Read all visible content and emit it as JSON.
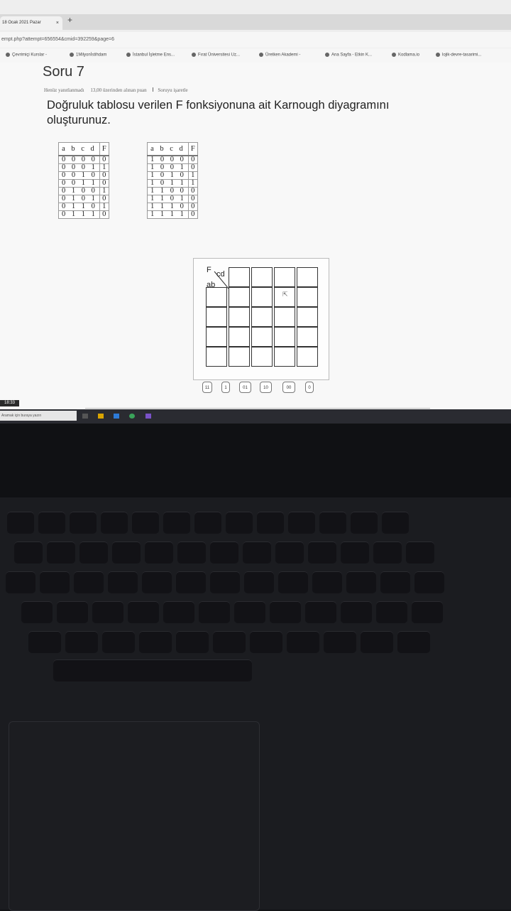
{
  "browser": {
    "tab_title": "18 Ocak 2021 Pazar",
    "tab_close": "×",
    "new_tab": "+",
    "address": "empt.php?attempt=656554&cmid=392259&page=6",
    "bookmarks": [
      "Çevrimiçi Kurslar -",
      "1Milyonİstihdam",
      "İstanbul İşletme Ens...",
      "Fırat Üniversitesi Uz...",
      "Üretken Akademi -",
      "Ana Sayfa - Etkin K...",
      "Kodlama.io",
      "lojik-devre-tasarimi..."
    ]
  },
  "question": {
    "title": "Soru 7",
    "status": "Henüz yanıtlanmadı",
    "points": "13,00 üzerinden alınan puan",
    "flag": "Soruyu işaretle",
    "text": "Doğruluk tablosu verilen F fonksiyonuna ait Karnough diyagramını oluşturunuz."
  },
  "truth_table": {
    "headers": [
      "a b c d",
      "F"
    ],
    "left_rows": [
      [
        "0 0 0 0",
        "0"
      ],
      [
        "0 0 0 1",
        "1"
      ],
      [
        "0 0 1 0",
        "0"
      ],
      [
        "0 0 1 1",
        "0"
      ],
      [
        "0 1 0 0",
        "1"
      ],
      [
        "0 1 0 1",
        "0"
      ],
      [
        "0 1 1 0",
        "1"
      ],
      [
        "0 1 1 1",
        "0"
      ]
    ],
    "right_rows": [
      [
        "1 0 0 0",
        "0"
      ],
      [
        "1 0 0 1",
        "0"
      ],
      [
        "1 0 1 0",
        "1"
      ],
      [
        "1 0 1 1",
        "1"
      ],
      [
        "1 1 0 0",
        "0"
      ],
      [
        "1 1 0 1",
        "0"
      ],
      [
        "1 1 1 0",
        "0"
      ],
      [
        "1 1 1 1",
        "0"
      ]
    ]
  },
  "kmap": {
    "f_label": "F",
    "cd_label": "cd",
    "ab_label": "ab",
    "drag_tiles": [
      "11",
      "1",
      "01",
      "10",
      "00",
      "0"
    ]
  },
  "taskbar": {
    "time": "18:33",
    "search_placeholder": "Aramak için buraya yazın"
  }
}
